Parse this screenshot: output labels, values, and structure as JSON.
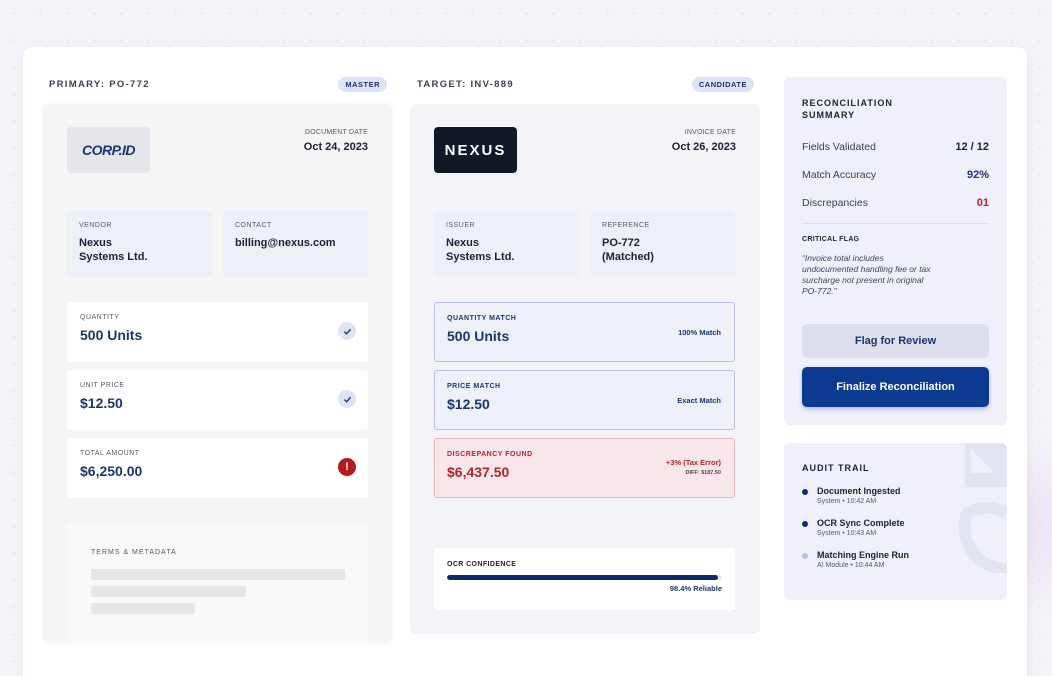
{
  "primary": {
    "title": "PRIMARY: PO-772",
    "badge": "MASTER",
    "logo": "CORP.ID",
    "date_label": "DOCUMENT DATE",
    "date_value": "Oct 24, 2023",
    "vendor_label": "VENDOR",
    "vendor_value": "Nexus\nSystems Ltd.",
    "contact_label": "CONTACT",
    "contact_value": "billing@nexus.com",
    "rows": [
      {
        "label": "QUANTITY",
        "value": "500 Units",
        "status_icon": "check-icon"
      },
      {
        "label": "UNIT PRICE",
        "value": "$12.50",
        "status_icon": "check-icon"
      },
      {
        "label": "TOTAL AMOUNT",
        "value": "$6,250.00",
        "status_icon": "alert-icon",
        "status_text": "!"
      }
    ],
    "terms_label": "TERMS & METADATA"
  },
  "target": {
    "title": "TARGET: INV-889",
    "badge": "CANDIDATE",
    "logo": "NEXUS",
    "date_label": "INVOICE DATE",
    "date_value": "Oct 26, 2023",
    "issuer_label": "ISSUER",
    "issuer_value": "Nexus\nSystems Ltd.",
    "reference_label": "REFERENCE",
    "reference_value": "PO-772\n(Matched)",
    "matches": [
      {
        "label": "QUANTITY MATCH",
        "value": "500 Units",
        "note": "100% Match"
      },
      {
        "label": "PRICE MATCH",
        "value": "$12.50",
        "note": "Exact Match"
      }
    ],
    "discrepancy": {
      "label": "DISCREPANCY FOUND",
      "value": "$6,437.50",
      "note": "+3% (Tax Error)",
      "diff": "DIFF: $187.50"
    },
    "ocr": {
      "label": "OCR CONFIDENCE",
      "percent": 98.4,
      "text": "98.4% Reliable"
    }
  },
  "summary": {
    "title": "RECONCILIATION\nSUMMARY",
    "rows": [
      {
        "key": "Fields Validated",
        "value": "12 / 12",
        "color": "#1b2233"
      },
      {
        "key": "Match Accuracy",
        "value": "92%",
        "color": "#1d356f"
      },
      {
        "key": "Discrepancies",
        "value": "01",
        "color": "#b1242c"
      }
    ],
    "flag_label": "CRITICAL FLAG",
    "flag_quote": "“Invoice total includes undocumented handling fee or tax surcharge not present in original PO-772.”",
    "flag_button": "Flag for Review",
    "finalize_button": "Finalize Reconciliation"
  },
  "audit": {
    "title": "AUDIT TRAIL",
    "items": [
      {
        "name": "Document Ingested",
        "meta": "System • 10:42 AM",
        "dot_color": "#0d2a6b"
      },
      {
        "name": "OCR Sync Complete",
        "meta": "System • 10:43 AM",
        "dot_color": "#0d2a6b"
      },
      {
        "name": "Matching Engine Run",
        "meta": "AI Module • 10:44 AM",
        "dot_color": "#b9c2e6"
      }
    ]
  }
}
